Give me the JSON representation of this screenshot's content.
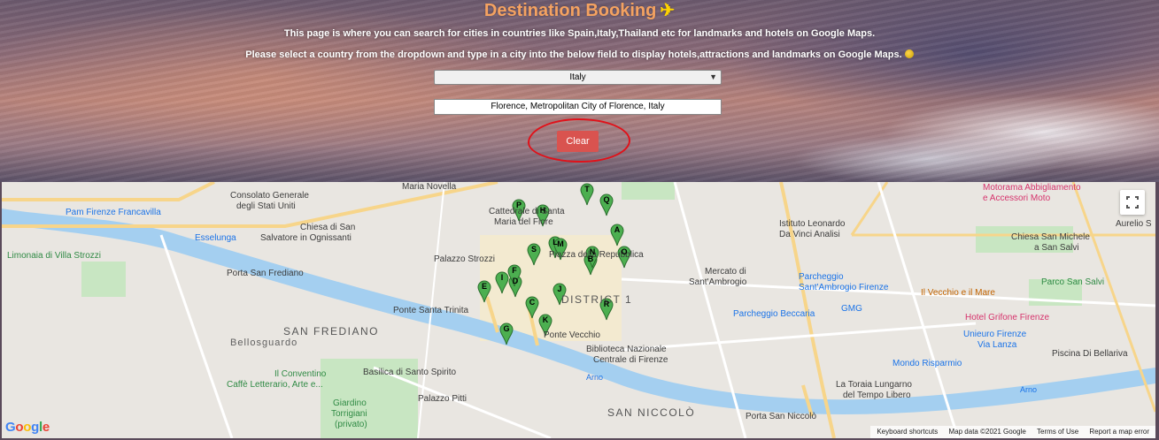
{
  "header": {
    "title": "Destination Booking",
    "plane_icon": "airplane-departure-icon",
    "description_1": "This page is where you can search for cities in countries like Spain,Italy,Thailand etc for landmarks and hotels on Google Maps.",
    "description_2": "Please select a country from the dropdown and type in a city into the below field to display hotels,attractions and landmarks on Google Maps."
  },
  "form": {
    "country_selected": "Italy",
    "city_value": "Florence, Metropolitan City of Florence, Italy",
    "clear_label": "Clear"
  },
  "colors": {
    "title": "#f4a261",
    "clear_button": "#d9534f",
    "scribble": "#e0121a",
    "pin": "#4caf50"
  },
  "map": {
    "labels": {
      "maria_novella": "Maria Novella",
      "consolato": "Consolato Generale",
      "consolato2": "degli Stati Uniti",
      "pam": "Pam Firenze Francavilla",
      "esselunga": "Esselunga",
      "chiesa_salvatore": "Chiesa di San",
      "chiesa_salvatore2": "Salvatore in Ognissanti",
      "limonaia": "Limonaia di Villa Strozzi",
      "porta_frediano": "Porta San Frediano",
      "palazzo_strozzi": "Palazzo Strozzi",
      "cattedrale": "Cattedrale di Santa",
      "cattedrale2": "Maria del Fiore",
      "repubblica": "Piazza della Repubblica",
      "district": "DISTRICT 1",
      "ponte_trinita": "Ponte Santa Trinita",
      "san_frediano": "SAN FREDIANO",
      "bellosguardo": "Bellosguardo",
      "ponte_vecchio": "Ponte Vecchio",
      "biblioteca": "Biblioteca Nazionale",
      "biblioteca2": "Centrale di Firenze",
      "conventino": "Il Conventino",
      "caffe": "Caffè Letterario, Arte e...",
      "basilica": "Basilica di Santo Spirito",
      "pitti": "Palazzo Pitti",
      "giardino": "Giardino",
      "giardino2": "Torrigiani",
      "giardino3": "(privato)",
      "san_niccolo": "SAN NICCOLÒ",
      "porta_niccolo": "Porta San Niccolò",
      "torre_zecca": "La Toraia Lungarno",
      "torre_zecca2": "del Tempo Libero",
      "mondo": "Mondo Risparmio",
      "unieuro": "Unieuro Firenze",
      "unieuro2": "Via Lanza",
      "piscina": "Piscina Di Bellariva",
      "hotel_grifone": "Hotel Grifone Firenze",
      "gmg": "GMG",
      "beccaria": "Parcheggio Beccaria",
      "parcheggio_ambrogio": "Parcheggio",
      "parcheggio_ambrogio2": "Sant'Ambrogio Firenze",
      "mercato": "Mercato di",
      "mercato2": "Sant'Ambrogio",
      "vecchio_mare": "Il Vecchio e il Mare",
      "parco_salvi": "Parco San Salvi",
      "chiesa_michele": "Chiesa San Michele",
      "chiesa_michele2": "a San Salvi",
      "istituto": "Istituto Leonardo",
      "istituto2": "Da Vinci Analisi",
      "motorama": "Motorama Abbigliamento",
      "motorama2": "e Accessori Moto",
      "aurelio": "Aurelio S",
      "arno": "Arno",
      "arno2": "Arno"
    },
    "pins": [
      "A",
      "B",
      "C",
      "D",
      "E",
      "F",
      "G",
      "H",
      "I",
      "J",
      "K",
      "L",
      "M",
      "N",
      "O",
      "P",
      "Q",
      "R",
      "S",
      "T"
    ],
    "google_logo": "Google",
    "attribution": {
      "shortcuts": "Keyboard shortcuts",
      "data": "Map data ©2021 Google",
      "terms": "Terms of Use",
      "report": "Report a map error"
    },
    "fullscreen_icon": "fullscreen-icon"
  }
}
